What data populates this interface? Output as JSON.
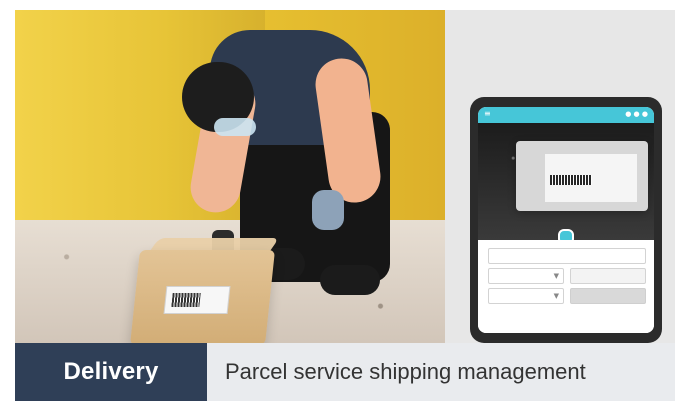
{
  "banner": {
    "left_label": "Delivery",
    "right_text": "Parcel service shipping management"
  },
  "colors": {
    "banner_left": "#2f3f57",
    "banner_right": "#e9ebee",
    "tablet_accent": "#46c6d8"
  },
  "icons": {
    "menu": "hamburger-menu-icon",
    "camera_capture": "camera-capture-icon",
    "dropdown": "chevron-down-icon"
  }
}
